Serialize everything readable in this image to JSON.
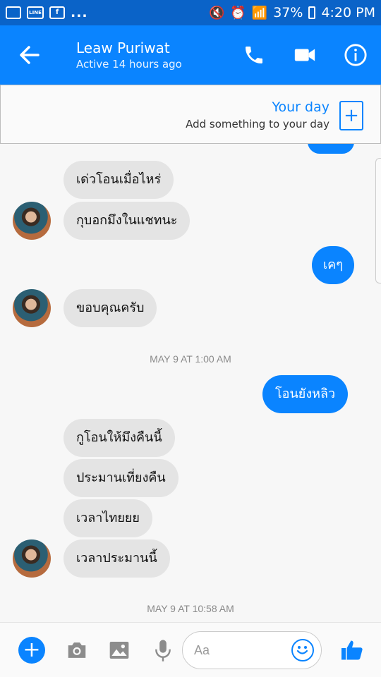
{
  "status_bar": {
    "dots": "...",
    "line_icon_text": "LINE",
    "battery_percent": "37%",
    "time": "4:20 PM"
  },
  "header": {
    "contact_name": "Leaw Puriwat",
    "active_status": "Active 14 hours ago"
  },
  "your_day": {
    "title": "Your day",
    "subtitle": "Add something to your day"
  },
  "messages": [
    {
      "from": "them",
      "text": "เด่วโอนเมื่อไหร่"
    },
    {
      "from": "them",
      "text": "กุบอกมึงในแชทนะ"
    },
    {
      "from": "me",
      "text": "เคๆ"
    },
    {
      "from": "them",
      "text": "ขอบคุณครับ"
    },
    {
      "from": "me",
      "text": "โอนยังหลิว"
    },
    {
      "from": "them",
      "text": "กูโอนให้มึงคืนนี้"
    },
    {
      "from": "them",
      "text": "ประมานเที่ยงคืน"
    },
    {
      "from": "them",
      "text": "เวลาไทยยย"
    },
    {
      "from": "them",
      "text": "เวลาประมานนี้"
    }
  ],
  "timestamps": [
    "MAY 9 AT 1:00 AM",
    "MAY 9 AT 10:58 AM"
  ],
  "composer": {
    "placeholder": "Aa"
  },
  "colors": {
    "status_bar": "#0a63c8",
    "accent": "#0a84ff",
    "incoming_bubble": "#e4e4e4",
    "outgoing_text": "#ffffff"
  }
}
